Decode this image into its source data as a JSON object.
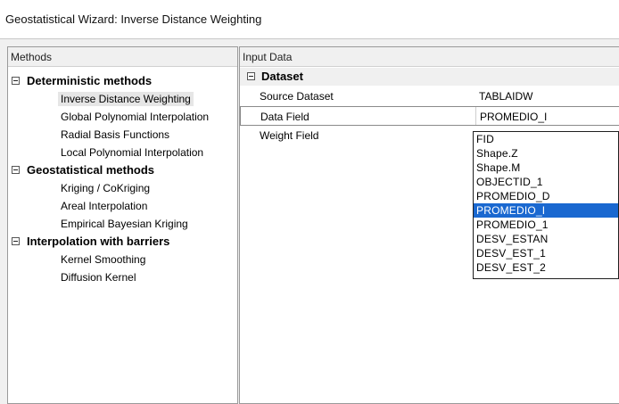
{
  "window": {
    "title": "Geostatistical Wizard: Inverse Distance Weighting"
  },
  "methods": {
    "header": "Methods",
    "groups": [
      {
        "label": "Deterministic methods",
        "items": [
          "Inverse Distance Weighting",
          "Global Polynomial Interpolation",
          "Radial Basis Functions",
          "Local Polynomial Interpolation"
        ]
      },
      {
        "label": "Geostatistical methods",
        "items": [
          "Kriging / CoKriging",
          "Areal Interpolation",
          "Empirical Bayesian Kriging"
        ]
      },
      {
        "label": "Interpolation with barriers",
        "items": [
          "Kernel Smoothing",
          "Diffusion Kernel"
        ]
      }
    ],
    "selected_item": "Inverse Distance Weighting"
  },
  "input": {
    "header": "Input Data",
    "section": "Dataset",
    "properties": [
      {
        "name": "Source Dataset",
        "value": "TABLAIDW"
      },
      {
        "name": "Data Field",
        "value": "PROMEDIO_I"
      },
      {
        "name": "Weight Field",
        "value": ""
      }
    ],
    "dropdown_options": [
      "FID",
      "Shape.Z",
      "Shape.M",
      "OBJECTID_1",
      "PROMEDIO_D",
      "PROMEDIO_I",
      "PROMEDIO_1",
      "DESV_ESTAN",
      "DESV_EST_1",
      "DESV_EST_2"
    ],
    "dropdown_selected": "PROMEDIO_I"
  }
}
